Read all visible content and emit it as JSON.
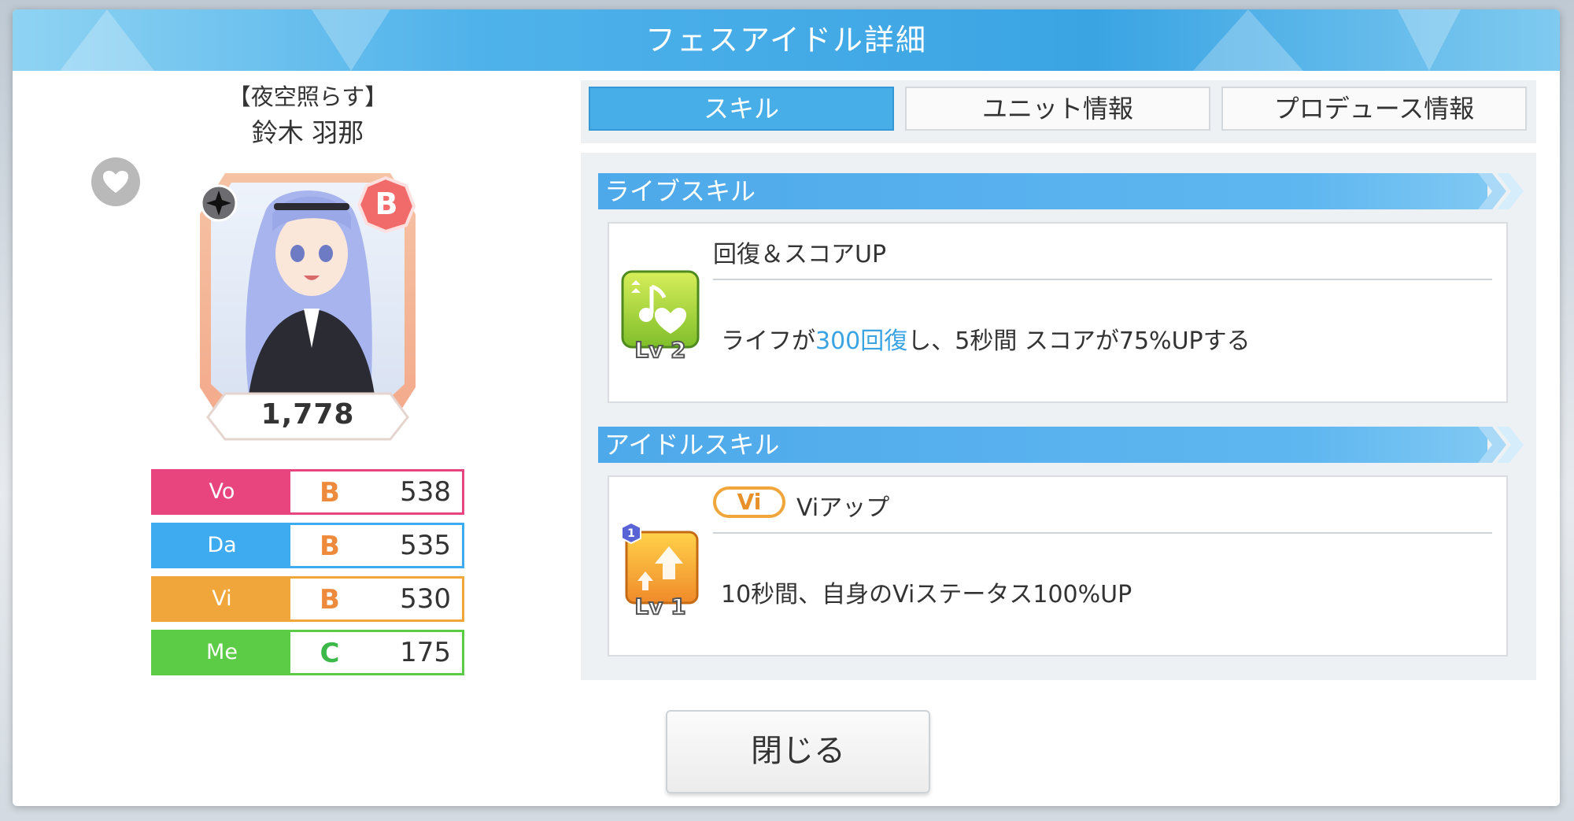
{
  "dialog": {
    "title": "フェスアイドル詳細"
  },
  "idol": {
    "card_title": "【夜空照らす】",
    "name": "鈴木 羽那",
    "card_rank": "B",
    "score": "1,778"
  },
  "stats": [
    {
      "label": "Vo",
      "grade": "B",
      "value": "538",
      "color": "#e8457f"
    },
    {
      "label": "Da",
      "grade": "B",
      "value": "535",
      "color": "#3eaaf0"
    },
    {
      "label": "Vi",
      "grade": "B",
      "value": "530",
      "color": "#f0a63a"
    },
    {
      "label": "Me",
      "grade": "C",
      "value": "175",
      "color": "#5ccb45"
    }
  ],
  "tabs": [
    {
      "label": "スキル",
      "active": true
    },
    {
      "label": "ユニット情報",
      "active": false
    },
    {
      "label": "プロデュース情報",
      "active": false
    }
  ],
  "live_skill": {
    "header": "ライブスキル",
    "name": "回復＆スコアUP",
    "level": "Lv 2",
    "desc_pre": "ライフが",
    "desc_highlight": "300回復",
    "desc_post": "し、5秒間 スコアが75%UPする"
  },
  "idol_skill": {
    "header": "アイドルスキル",
    "badge": "Vi",
    "name": "Viアップ",
    "level": "Lv 1",
    "rank_badge": "1",
    "desc": "10秒間、自身のViステータス100%UP"
  },
  "close_button": "閉じる",
  "colors": {
    "accent": "#3aa4e3",
    "title_bar": "#4fb2ea"
  }
}
